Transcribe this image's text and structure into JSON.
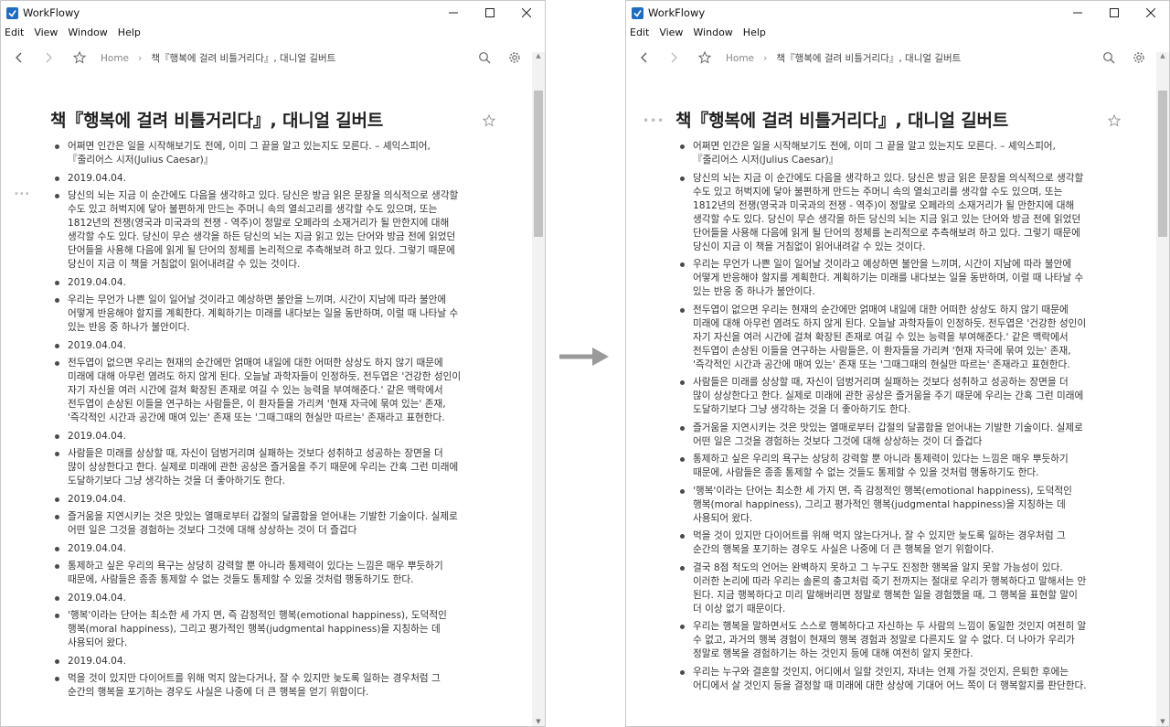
{
  "left_window": {
    "title": "WorkFlowy",
    "menu": [
      "Edit",
      "View",
      "Window",
      "Help"
    ],
    "breadcrumb": {
      "home": "Home",
      "current": "책『행복에 걸려 비틀거리다』, 대니얼 길버트"
    },
    "doc_title": "책『행복에 걸려 비틀거리다』, 대니얼 길버트",
    "bullets": [
      "어쩌면 인간은 일을 시작해보기도 전에, 이미 그 끝을 알고 있는지도 모른다. – 셰익스피어,『줄리어스 시저(Julius Caesar)』",
      "2019.04.04.",
      "당신의 뇌는 지금 이 순간에도 다음을 생각하고 있다. 당신은 방금 읽은 문장을 의식적으로 생각할 수도 있고 허벅지에 닿아 불편하게 만드는 주머니 속의 열쇠고리를 생각할 수도 있으며, 또는 1812년의 전쟁(영국과 미국과의 전쟁 - 역주)이 정말로 오페라의 소재거리가 될 만한지에 대해 생각할 수도 있다. 당신이 무슨 생각을 하든 당신의 뇌는 지금 읽고 있는 단어와 방금 전에 읽었던 단어들을 사용해 다음에 읽게 될 단어의 정체를 논리적으로 추측해보려 하고 있다. 그렇기 때문에 당신이 지금 이 책을 거침없이 읽어내려갈 수 있는 것이다.",
      "2019.04.04.",
      "우리는 무언가 나쁜 일이 일어날 것이라고 예상하면 불안을 느끼며, 시간이 지남에 따라 불안에 어떻게 반응해야 할지를 계획한다. 계획하기는 미래를 내다보는 일을 동반하며, 이럴 때 나타날 수 있는 반응 중 하나가 불안이다.",
      "2019.04.04.",
      "전두엽이 없으면 우리는 현재의 순간에만 얽매여 내일에 대한 어떠한 상상도 하지 않기 때문에 미래에 대해 아무런 염려도 하지 않게 된다. 오늘날 과학자들이 인정하듯, 전두엽은 '건강한 성인이 자기 자신을 여러 시간에 걸쳐 확장된 존재로 여길 수 있는 능력을 부여해준다.' 같은 맥락에서 전두엽이 손상된 이들을 연구하는 사람들은, 이 환자들을 가리켜 '현재 자극에 묶여 있는' 존재, '즉각적인 시간과 공간에 매여 있는' 존재 또는 '그때그때의 현실만 따르는' 존재라고 표현한다.",
      "2019.04.04.",
      "사람들은 미래를 상상할 때, 자신이 덤벙거리며 실패하는 것보다 성취하고 성공하는 장면을 더 많이 상상한다고 한다. 실제로 미래에 관한 공상은 즐거움을 주기 때문에 우리는 간혹 그런 미래에 도달하기보다 그냥 생각하는 것을 더 좋아하기도 한다.",
      "2019.04.04.",
      "즐거움을 지연시키는 것은 맛있는 열매로부터 갑절의 달콤함을 얻어내는 기발한 기술이다. 실제로 어떤 일은 그것을 경험하는 것보다 그것에 대해 상상하는 것이 더 즐겁다",
      "2019.04.04.",
      "통제하고 싶은 우리의 욕구는 상당히 강력할 뿐 아니라 통제력이 있다는 느낌은 매우 뿌듯하기 때문에, 사람들은 종종 통제할 수 없는 것들도 통제할 수 있을 것처럼 행동하기도 한다.",
      "2019.04.04.",
      "'행복'이라는 단어는 최소한 세 가지 면, 즉 감정적인 행복(emotional happiness), 도덕적인 행복(moral happiness), 그리고 평가적인 행복(judgmental happiness)을 지칭하는 데 사용되어 왔다.",
      "2019.04.04.",
      "먹을 것이 있지만 다이어트를 위해 먹지 않는다거나, 잘 수 있지만 늦도록 일하는 경우처럼 그 순간의 행복을 포기하는 경우도 사실은 나중에 더 큰 행복을 얻기 위함이다."
    ]
  },
  "right_window": {
    "title": "WorkFlowy",
    "menu": [
      "Edit",
      "View",
      "Window",
      "Help"
    ],
    "breadcrumb": {
      "home": "Home",
      "current": "책『행복에 걸려 비틀거리다』, 대니얼 길버트"
    },
    "doc_title": "책『행복에 걸려 비틀거리다』, 대니얼 길버트",
    "bullets": [
      "어쩌면 인간은 일을 시작해보기도 전에, 이미 그 끝을 알고 있는지도 모른다. – 셰익스피어,『줄리어스 시저(Julius Caesar)』",
      "당신의 뇌는 지금 이 순간에도 다음을 생각하고 있다. 당신은 방금 읽은 문장을 의식적으로 생각할 수도 있고 허벅지에 닿아 불편하게 만드는 주머니 속의 열쇠고리를 생각할 수도 있으며, 또는 1812년의 전쟁(영국과 미국과의 전쟁 - 역주)이 정말로 오페라의 소재거리가 될 만한지에 대해 생각할 수도 있다. 당신이 무슨 생각을 하든 당신의 뇌는 지금 읽고 있는 단어와 방금 전에 읽었던 단어들을 사용해 다음에 읽게 될 단어의 정체를 논리적으로 추측해보려 하고 있다. 그렇기 때문에 당신이 지금 이 책을 거침없이 읽어내려갈 수 있는 것이다.",
      "우리는 무언가 나쁜 일이 일어날 것이라고 예상하면 불안을 느끼며, 시간이 지남에 따라 불안에 어떻게 반응해야 할지를 계획한다. 계획하기는 미래를 내다보는 일을 동반하며, 이럴 때 나타날 수 있는 반응 중 하나가 불안이다.",
      "전두엽이 없으면 우리는 현재의 순간에만 얽매여 내일에 대한 어떠한 상상도 하지 않기 때문에 미래에 대해 아무런 염려도 하지 않게 된다. 오늘날 과학자들이 인정하듯, 전두엽은 '건강한 성인이 자기 자신을 여러 시간에 걸쳐 확장된 존재로 여길 수 있는 능력을 부여해준다.' 같은 맥락에서 전두엽이 손상된 이들을 연구하는 사람들은, 이 환자들을 가리켜 '현재 자극에 묶여 있는' 존재, '즉각적인 시간과 공간에 매여 있는' 존재 또는 '그때그때의 현실만 따르는' 존재라고 표현한다.",
      "사람들은 미래를 상상할 때, 자신이 덤벙거리며 실패하는 것보다 성취하고 성공하는 장면을 더 많이 상상한다고 한다. 실제로 미래에 관한 공상은 즐거움을 주기 때문에 우리는 간혹 그런 미래에 도달하기보다 그냥 생각하는 것을 더 좋아하기도 한다.",
      "즐거움을 지연시키는 것은 맛있는 열매로부터 갑절의 달콤함을 얻어내는 기발한 기술이다. 실제로 어떤 일은 그것을 경험하는 것보다 그것에 대해 상상하는 것이 더 즐겁다",
      "통제하고 싶은 우리의 욕구는 상당히 강력할 뿐 아니라 통제력이 있다는 느낌은 매우 뿌듯하기 때문에, 사람들은 종종 통제할 수 없는 것들도 통제할 수 있을 것처럼 행동하기도 한다.",
      "'행복'이라는 단어는 최소한 세 가지 면, 즉 감정적인 행복(emotional happiness), 도덕적인 행복(moral happiness), 그리고 평가적인 행복(judgmental happiness)을 지칭하는 데 사용되어 왔다.",
      "먹을 것이 있지만 다이어트를 위해 먹지 않는다거나, 잘 수 있지만 늦도록 일하는 경우처럼 그 순간의 행복을 포기하는 경우도 사실은 나중에 더 큰 행복을 얻기 위함이다.",
      "결국 8점 척도의 언어는 완벽하지 못하고 그 누구도 진정한 행복을 알지 못할 가능성이 있다. 이러한 논리에 따라 우리는 솔론의 충고처럼 죽기 전까지는 절대로 우리가 행복하다고 말해서는 안 된다. 지금 행복하다고 미리 말해버리면 정말로 행복한 일을 경험했을 때, 그 행복을 표현할 말이 더 이상 없기 때문이다.",
      "우리는 행복을 말하면서도 스스로 행복하다고 자신하는 두 사람의 느낌이 동일한 것인지 여전히 알 수 없고, 과거의 행복 경험이 현재의 행복 경험과 정말로 다른지도 알 수 없다. 더 나아가 우리가 정말로 행복을 경험하기는 하는 것인지 등에 대해 여전히 알지 못한다.",
      "우리는 누구와 결혼할 것인지, 어디에서 일할 것인지, 자녀는 언제 가질 것인지, 은퇴한 후에는 어디에서 살 것인지 등을 결정할 때 미래에 대한 상상에 기대어 어느 쪽이 더 행복할지를 판단한다."
    ]
  },
  "scroll": {
    "left_position": 0.06,
    "right_position": 0.06
  }
}
